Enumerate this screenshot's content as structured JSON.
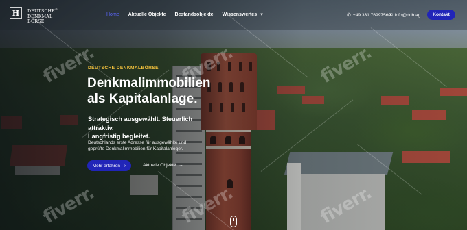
{
  "brand": {
    "mark": "H",
    "name_lines": [
      "DEUTSCHE",
      "DENKMAL",
      "BÖRSE"
    ],
    "registered": "®"
  },
  "nav": {
    "items": [
      {
        "label": "Home",
        "active": true
      },
      {
        "label": "Aktuelle Objekte",
        "active": false
      },
      {
        "label": "Bestandsobjekte",
        "active": false
      },
      {
        "label": "Wissenswertes",
        "active": false,
        "dropdown": true
      }
    ]
  },
  "contact": {
    "phone": "+49 331 76997560",
    "email": "info@ddb.ag",
    "button_label": "Kontakt"
  },
  "hero": {
    "eyebrow": "DEUTSCHE DENKMALBÖRSE",
    "headline_line1": "Denkmalimmobilien",
    "headline_line2": "als Kapitalanlage.",
    "subhead_line1": "Strategisch ausgewählt. Steuerlich attraktiv.",
    "subhead_line2": "Langfristig begleitet.",
    "description_line1": "Deutschlands erste Adresse für ausgewählte und",
    "description_line2": "geprüfte Denkmalimmobilien für Kapitalanleger.",
    "primary_button": "Mehr erfahren",
    "secondary_link": "Aktuelle Objekte"
  },
  "icons": {
    "phone": "phone-icon",
    "email": "mail-icon",
    "chevron": "chevron-down-icon",
    "arrow": "arrow-right-icon",
    "scroll": "scroll-indicator-icon"
  },
  "colors": {
    "accent": "#2125b8",
    "active_nav": "#5c67ff",
    "eyebrow": "#f3c13c"
  },
  "watermark": "fiverr."
}
